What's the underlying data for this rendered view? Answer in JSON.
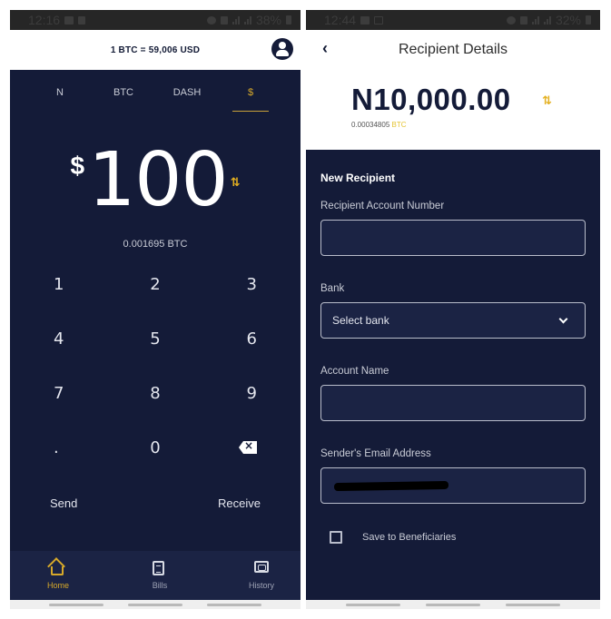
{
  "left_screen": {
    "status_bar": {
      "time": "12:16",
      "battery": "38%"
    },
    "header": {
      "rate": "1 BTC  = 59,006 USD"
    },
    "currency_tabs": [
      {
        "label": "N",
        "active": false
      },
      {
        "label": "BTC",
        "active": false
      },
      {
        "label": "DASH",
        "active": false
      },
      {
        "label": "$",
        "active": true
      }
    ],
    "amount": {
      "currency_symbol": "$",
      "value": "100",
      "btc_equivalent": "0.001695 BTC",
      "swap_glyph": "⇅"
    },
    "keypad": [
      "1",
      "2",
      "3",
      "4",
      "5",
      "6",
      "7",
      "8",
      "9",
      ".",
      "0",
      "⌫"
    ],
    "actions": {
      "send": "Send",
      "receive": "Receive"
    },
    "bottom_nav": [
      {
        "label": "Home",
        "icon": "home-icon",
        "active": true
      },
      {
        "label": "Bills",
        "icon": "bills-icon",
        "active": false
      },
      {
        "label": "History",
        "icon": "wallet-icon",
        "active": false
      }
    ]
  },
  "right_screen": {
    "status_bar": {
      "time": "12:44",
      "battery": "32%"
    },
    "header": {
      "back_glyph": "‹",
      "title": "Recipient Details"
    },
    "amount": {
      "value": "N10,000.00",
      "btc_value": "0.00034805",
      "btc_unit": "BTC",
      "swap_glyph": "⇅"
    },
    "form": {
      "section_title": "New Recipient",
      "fields": {
        "account_number": {
          "label": "Recipient Account Number",
          "value": ""
        },
        "bank": {
          "label": "Bank",
          "placeholder": "Select bank"
        },
        "account_name": {
          "label": "Account Name",
          "value": ""
        },
        "email": {
          "label": "Sender's Email Address",
          "value": "[redacted]"
        }
      },
      "save_checkbox": {
        "label": "Save to Beneficiaries",
        "checked": false
      }
    }
  },
  "colors": {
    "navy": "#141b38",
    "accent_gold": "#d7a92a",
    "swap_yellow": "#e4b020"
  }
}
